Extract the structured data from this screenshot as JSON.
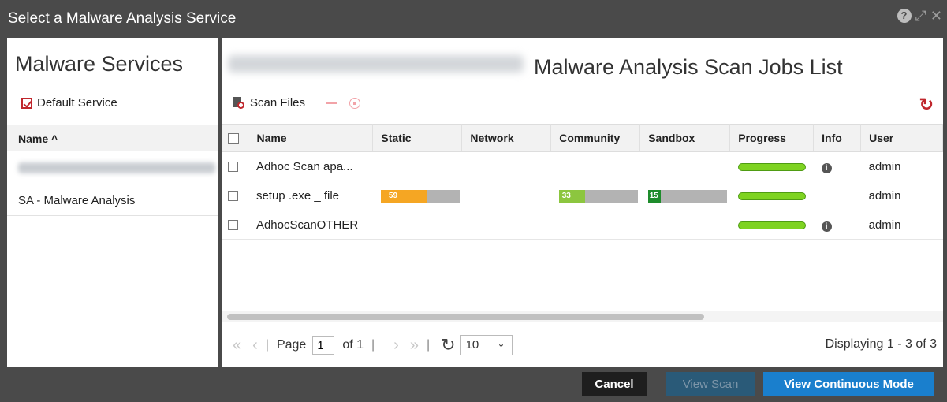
{
  "window": {
    "title": "Select a Malware Analysis Service",
    "help_icon": "question-circle-icon",
    "controls": [
      "expand-icon",
      "close-icon"
    ]
  },
  "sidebar": {
    "heading": "Malware Services",
    "default_service": {
      "label": "Default Service",
      "checked": true
    },
    "column": "Name ^",
    "items": [
      {
        "label": "",
        "redacted": true
      },
      {
        "label": "SA - Malware Analysis"
      }
    ]
  },
  "main": {
    "heading": "Malware Analysis Scan Jobs List",
    "host_redacted": true,
    "toolbar": {
      "scan_files": "Scan Files"
    },
    "columns": [
      "Name",
      "Static",
      "Network",
      "Community",
      "Sandbox",
      "Progress",
      "Info",
      "User"
    ],
    "rows": [
      {
        "name": "Adhoc Scan apa...",
        "static": "",
        "network": "",
        "community": "",
        "sandbox": "",
        "progress": 1.0,
        "info": true,
        "user": "admin"
      },
      {
        "name": "setup .exe _ file",
        "static": "59",
        "network": "",
        "community": "33",
        "sandbox": "15",
        "progress": 1.0,
        "info": false,
        "user": "admin"
      },
      {
        "name": "AdhocScanOTHER",
        "static": "",
        "network": "",
        "community": "",
        "sandbox": "",
        "progress": 1.0,
        "info": true,
        "user": "admin"
      }
    ],
    "score_colors": {
      "static": "#f5a623",
      "community": "#8cc63f",
      "sandbox": "#1e8c2c"
    },
    "pager": {
      "first": "«",
      "prev": "‹",
      "page_label": "Page",
      "page_value": "1",
      "of": "of 1",
      "next": "›",
      "last": "»",
      "page_size": "10",
      "display": "Displaying 1 - 3 of 3"
    }
  },
  "footer": {
    "cancel": "Cancel",
    "view_scan": "View Scan",
    "view_continuous": "View Continuous Mode"
  }
}
